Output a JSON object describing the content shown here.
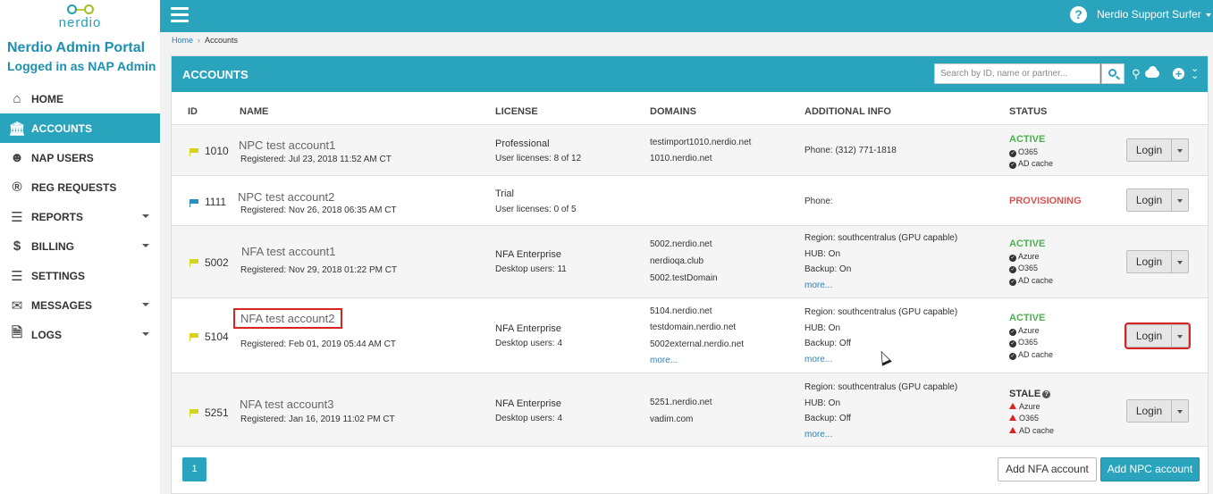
{
  "app": {
    "logo_text": "nerdio",
    "portal_title": "Nerdio Admin Portal",
    "logged_in": "Logged in as NAP Admin"
  },
  "sidebar": {
    "items": [
      {
        "label": "HOME",
        "icon": "home-icon"
      },
      {
        "label": "ACCOUNTS",
        "icon": "bank-icon",
        "active": true
      },
      {
        "label": "NAP USERS",
        "icon": "users-icon"
      },
      {
        "label": "REG REQUESTS",
        "icon": "registered-icon"
      },
      {
        "label": "REPORTS",
        "icon": "list-icon",
        "has_submenu": true
      },
      {
        "label": "BILLING",
        "icon": "dollar-icon",
        "has_submenu": true
      },
      {
        "label": "SETTINGS",
        "icon": "sliders-icon"
      },
      {
        "label": "MESSAGES",
        "icon": "envelope-icon",
        "has_submenu": true
      },
      {
        "label": "LOGS",
        "icon": "file-code-icon",
        "has_submenu": true
      }
    ]
  },
  "topbar": {
    "help": "?",
    "user": "Nerdio Support Surfer"
  },
  "breadcrumb": {
    "home": "Home",
    "sep": "›",
    "current": "Accounts"
  },
  "panel": {
    "title": "ACCOUNTS",
    "search_placeholder": "Search by ID, name or partner..."
  },
  "table": {
    "headers": {
      "id": "ID",
      "name": "NAME",
      "license": "LICENSE",
      "domains": "DOMAINS",
      "info": "ADDITIONAL INFO",
      "status": "STATUS"
    },
    "rows": [
      {
        "id": "1010",
        "flag": "yellow",
        "name": "NPC test account1",
        "registered": "Registered: Jul 23, 2018 11:52 AM CT",
        "license": "Professional",
        "license_detail": "User licenses: 8 of 12",
        "domains": [
          "testimport1010.nerdio.net",
          "1010.nerdio.net"
        ],
        "info": [
          "Phone: (312) 771-1818"
        ],
        "status": "ACTIVE",
        "services": [
          "O365",
          "AD cache"
        ],
        "login": "Login"
      },
      {
        "id": "1111",
        "flag": "blue",
        "name": "NPC test account2",
        "registered": "Registered: Nov 26, 2018 06:35 AM CT",
        "license": "Trial",
        "license_detail": "User licenses: 0 of 5",
        "domains": [],
        "info": [
          "Phone:"
        ],
        "status": "PROVISIONING",
        "services": [],
        "login": "Login"
      },
      {
        "id": "5002",
        "flag": "yellow",
        "name": "NFA test account1",
        "registered": "Registered: Nov 29, 2018 01:22 PM CT",
        "license": "NFA Enterprise",
        "license_detail": "Desktop users: 11",
        "domains": [
          "5002.nerdio.net",
          "nerdioqa.club",
          "5002.testDomain"
        ],
        "info": [
          "Region: southcentralus (GPU capable)",
          "HUB: On",
          "Backup: On"
        ],
        "info_more": "more...",
        "status": "ACTIVE",
        "services": [
          "Azure",
          "O365",
          "AD cache"
        ],
        "login": "Login"
      },
      {
        "id": "5104",
        "flag": "yellow",
        "name": "NFA test account2",
        "registered": "Registered: Feb 01, 2019 05:44 AM CT",
        "license": "NFA Enterprise",
        "license_detail": "Desktop users: 4",
        "domains": [
          "5104.nerdio.net",
          "testdomain.nerdio.net",
          "5002external.nerdio.net"
        ],
        "domains_more": "more...",
        "info": [
          "Region: southcentralus (GPU capable)",
          "HUB: On",
          "Backup: Off"
        ],
        "info_more": "more...",
        "status": "ACTIVE",
        "services": [
          "Azure",
          "O365",
          "AD cache"
        ],
        "login": "Login"
      },
      {
        "id": "5251",
        "flag": "yellow",
        "name": "NFA test account3",
        "registered": "Registered: Jan 16, 2019 11:02 PM CT",
        "license": "NFA Enterprise",
        "license_detail": "Desktop users: 4",
        "domains": [
          "5251.nerdio.net",
          "vadim.com"
        ],
        "info": [
          "Region: southcentralus (GPU capable)",
          "HUB: On",
          "Backup: Off"
        ],
        "info_more": "more...",
        "status": "STALE",
        "services": [
          "Azure",
          "O365",
          "AD cache"
        ],
        "login": "Login"
      }
    ]
  },
  "footer": {
    "page": "1",
    "add_nfa": "Add NFA account",
    "add_npc": "Add NPC account"
  },
  "colors": {
    "accent": "#2aa3bd",
    "active": "#4bb04f",
    "provisioning": "#d9534f",
    "warning": "#d9231f"
  }
}
